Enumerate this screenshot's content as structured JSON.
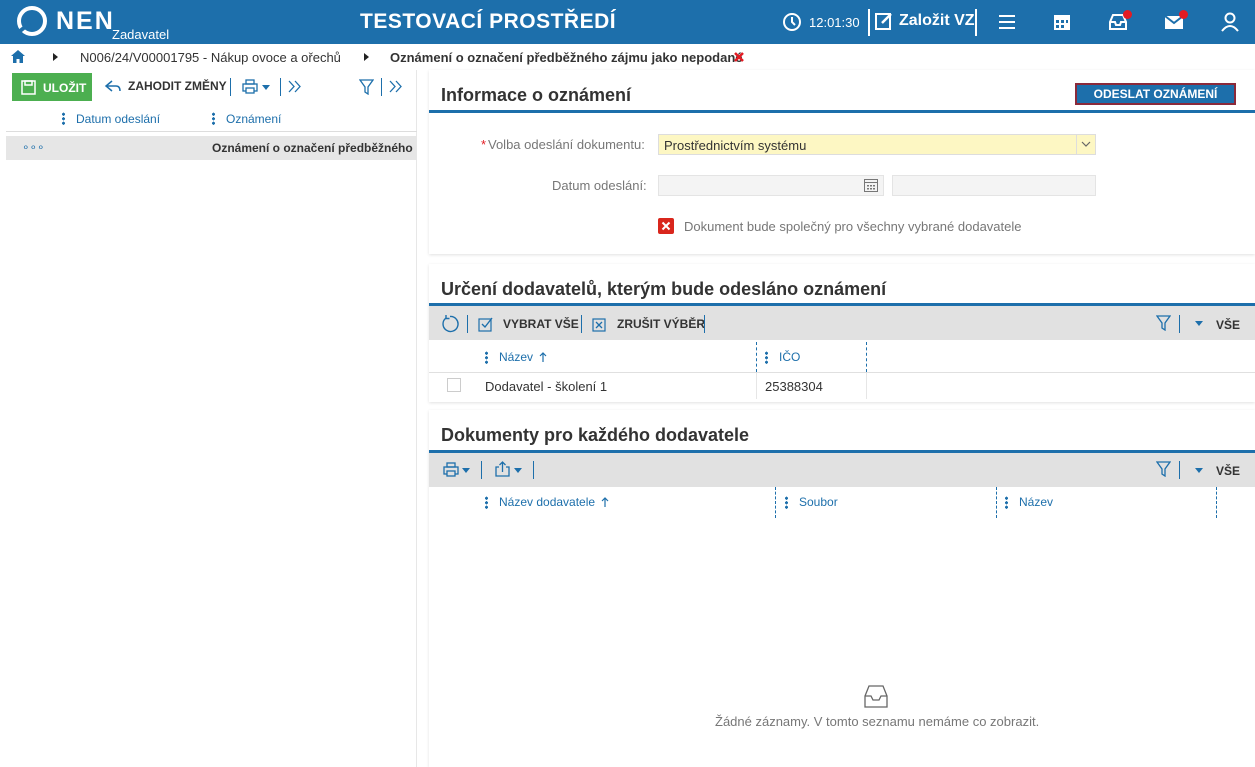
{
  "topbar": {
    "logo_text": "NEN",
    "logo_sub": "Zadavatel",
    "environment": "TESTOVACÍ PROSTŘEDÍ",
    "time": "12:01:30",
    "create_label": "Založit VZ",
    "brand_color": "#1d6fab"
  },
  "breadcrumb": {
    "items": [
      "N006/24/V00001795 - Nákup ovoce a ořechů",
      "Oznámení o označení předběžného zájmu jako nepodané"
    ]
  },
  "left": {
    "save_label": "ULOŽIT",
    "discard_label": "ZAHODIT ZMĚNY",
    "columns": [
      "Datum odeslání",
      "Oznámení"
    ],
    "row": {
      "menu": "∘∘∘",
      "date": "",
      "notice": "Oznámení o označení předběžného"
    }
  },
  "info": {
    "title": "Informace o oznámení",
    "send_button": "ODESLAT OZNÁMENÍ",
    "send_method_label": "Volba odeslání dokumentu:",
    "send_method_value": "Prostřednictvím systému",
    "send_date_label": "Datum odeslání:",
    "send_date_value": "",
    "send_time_value": "",
    "common_doc_label": "Dokument bude společný pro všechny vybrané dodavatele"
  },
  "suppliers": {
    "title": "Určení dodavatelů, kterým bude odesláno oznámení",
    "select_all": "VYBRAT VŠE",
    "deselect": "ZRUŠIT VÝBĚR",
    "filter_scope": "VŠE",
    "columns": [
      "Název",
      "IČO"
    ],
    "rows": [
      {
        "name": "Dodavatel - školení 1",
        "ico": "25388304"
      }
    ]
  },
  "documents": {
    "title": "Dokumenty pro každého dodavatele",
    "filter_scope": "VŠE",
    "columns": [
      "Název dodavatele",
      "Soubor",
      "Název"
    ],
    "empty_text": "Žádné záznamy. V tomto seznamu nemáme co zobrazit."
  }
}
